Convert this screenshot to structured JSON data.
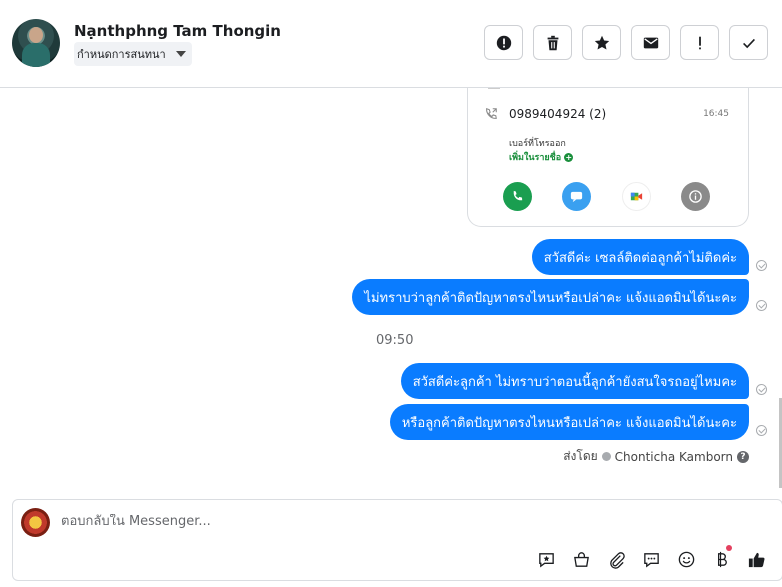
{
  "header": {
    "contact_name": "Nạnthphng Tam Thongin",
    "assign_label": "กำหนดการสนทนา",
    "actions": [
      {
        "icon": "alert-circle-icon",
        "name": "mark-spam-button"
      },
      {
        "icon": "trash-icon",
        "name": "delete-button"
      },
      {
        "icon": "star-icon",
        "name": "star-button"
      },
      {
        "icon": "envelope-icon",
        "name": "mark-unread-button"
      },
      {
        "icon": "exclamation-icon",
        "name": "follow-up-button"
      },
      {
        "icon": "check-icon",
        "name": "mark-done-button"
      }
    ]
  },
  "call_card": {
    "number": "0989404924 (2)",
    "time": "16:45",
    "label": "เบอร์ที่โทรออก",
    "add_label": "เพิ่มในรายชื่อ",
    "colors": {
      "call": "#1a9e50",
      "message": "#3aa0f0",
      "meet": "#ffffff",
      "info": "#8a8a8a"
    }
  },
  "messages": [
    {
      "text": "สวัสดีค่ะ เซลล์ติดต่อลูกค้าไม่ติดค่ะ"
    },
    {
      "text": "ไม่ทราบว่าลูกค้าติดปัญหาตรงไหนหรือเปล่าคะ แจ้งแอดมินได้นะคะ"
    },
    {
      "text": "สวัสดีค่ะลูกค้า ไม่ทราบว่าตอนนี้ลูกค้ายังสนใจรถอยู่ไหมคะ"
    },
    {
      "text": "หรือลูกค้าติดปัญหาตรงไหนหรือเปล่าคะ แจ้งแอดมินได้นะคะ"
    }
  ],
  "timestamp": "09:50",
  "sent_by": {
    "prefix": "ส่งโดย",
    "name": "Chonticha Kamborn"
  },
  "composer": {
    "placeholder": "ตอบกลับใน Messenger...",
    "tools": [
      "saved-reply-icon",
      "shopping-bag-icon",
      "paperclip-icon",
      "chat-bubble-icon",
      "emoji-icon",
      "currency-icon",
      "like-icon"
    ]
  },
  "colors": {
    "accent": "#0a7cff",
    "border": "#dadde1"
  }
}
